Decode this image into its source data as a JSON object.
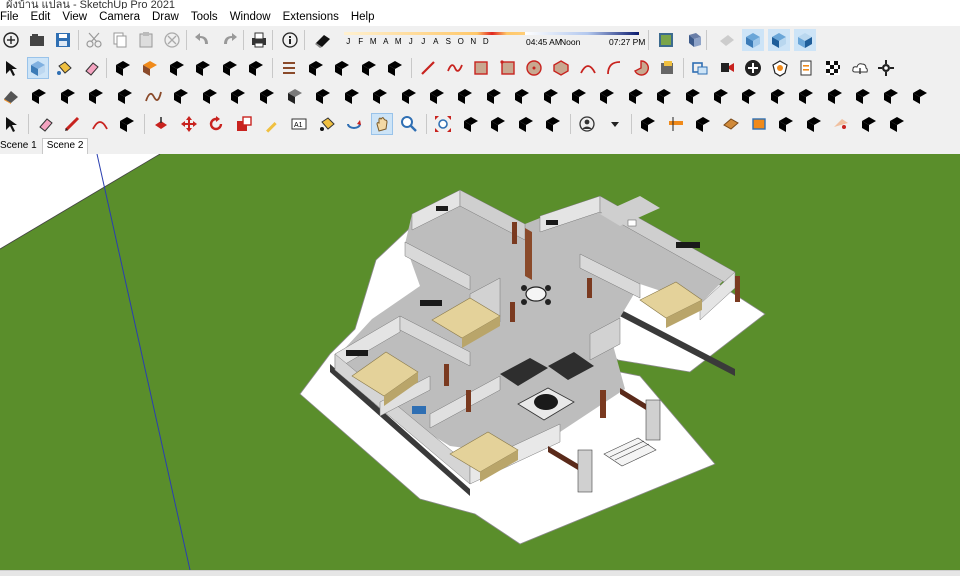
{
  "window": {
    "title": "ผังบ้าน แปลน - SketchUp Pro 2021"
  },
  "menus": [
    "File",
    "Edit",
    "View",
    "Camera",
    "Draw",
    "Tools",
    "Window",
    "Extensions",
    "Help"
  ],
  "shadow_settings": {
    "months": [
      "J",
      "F",
      "M",
      "A",
      "M",
      "J",
      "J",
      "A",
      "S",
      "O",
      "N",
      "D"
    ],
    "time_start": "04:45 AM",
    "time_mid": "Noon",
    "time_end": "07:27 PM"
  },
  "scenes": [
    {
      "label": "Scene 1",
      "selected": false
    },
    {
      "label": "Scene 2",
      "selected": true
    }
  ],
  "colors": {
    "ground": "#5a8e2b",
    "sky": "#ffffff",
    "wall": "#d7d7d7",
    "floor": "#bdbdbd",
    "bed": "#e4d29a",
    "slab": "#ffffff",
    "accent_blue": "#2f6fb3",
    "accent_red": "#c8231f"
  },
  "icons": {
    "row1": [
      "new-icon",
      "open-icon",
      "save-icon",
      "cut-icon",
      "copy-icon",
      "paste-icon",
      "erase-icon",
      "undo-icon",
      "redo-icon",
      "print-icon",
      "model-info-icon",
      "shadows-icon",
      "photo-textures-icon",
      "add-location-icon",
      "orbit-section-icon",
      "iso-view-icon",
      "front-view-icon",
      "right-view-icon"
    ],
    "row2": [
      "select-icon",
      "component-icon",
      "paint-bucket-icon",
      "eraser-icon",
      "warehouse-icon",
      "door-icon",
      "house-icon",
      "house-outline-icon",
      "house-open-icon",
      "box-icon",
      "component-group-icon",
      "layer-icon",
      "layer-alt-icon",
      "layer-blue-icon",
      "layer-cube-icon",
      "pencil-line-icon",
      "freehand-icon",
      "rectangle-icon",
      "rotated-rectangle-icon",
      "circle-icon",
      "polygon-icon",
      "arc-icon",
      "two-point-arc-icon",
      "pie-icon",
      "model-info-box-icon",
      "dimensions-icon",
      "scene-icon",
      "add-icon",
      "shield-icon",
      "doc-icon",
      "checker-icon",
      "cloud-upload-icon",
      "settings-icon"
    ],
    "row3": [
      "follow-me-icon",
      "dashed-path-icon",
      "scissors-icon",
      "loop-icon",
      "glasses-icon",
      "link-icon",
      "cube-wire-icon",
      "cube-line-icon",
      "curve-icon",
      "corner-icon",
      "corner-alt-icon",
      "angle-icon",
      "stair-icon",
      "stair-alt-icon",
      "rail-icon",
      "columns-icon",
      "grid-icon",
      "hand-icon",
      "shape-icon",
      "pull-icon",
      "push-icon",
      "extrude-icon",
      "sweep-icon",
      "lines-icon",
      "stripes-icon",
      "bars-icon",
      "bars-alt-icon",
      "note-icon",
      "hatch-icon",
      "zigzag-icon",
      "terrain-icon",
      "mesh-icon",
      "sandbox-icon"
    ],
    "row4": [
      "select-arrow-icon",
      "eraser-pink-icon",
      "pencil-red-icon",
      "arc-red-icon",
      "shape-brown-icon",
      "push-pull-icon",
      "move-icon",
      "rotate-icon",
      "scale-icon",
      "tape-measure-icon",
      "text-icon",
      "paint-icon",
      "orbit-icon",
      "pan-icon",
      "zoom-icon",
      "zoom-extents-icon",
      "sandbox-wave-icon",
      "sandbox-layers-icon",
      "sandbox-drape-icon",
      "sandbox-flip-icon",
      "user-icon",
      "dropdown-icon",
      "pencil-grey-icon",
      "section-plane-icon",
      "follow-path-icon",
      "wood-icon",
      "orange-box-icon",
      "wrap-icon",
      "fold-icon",
      "cut-red-icon",
      "double-arrow-icon",
      "corner-red-icon"
    ]
  }
}
